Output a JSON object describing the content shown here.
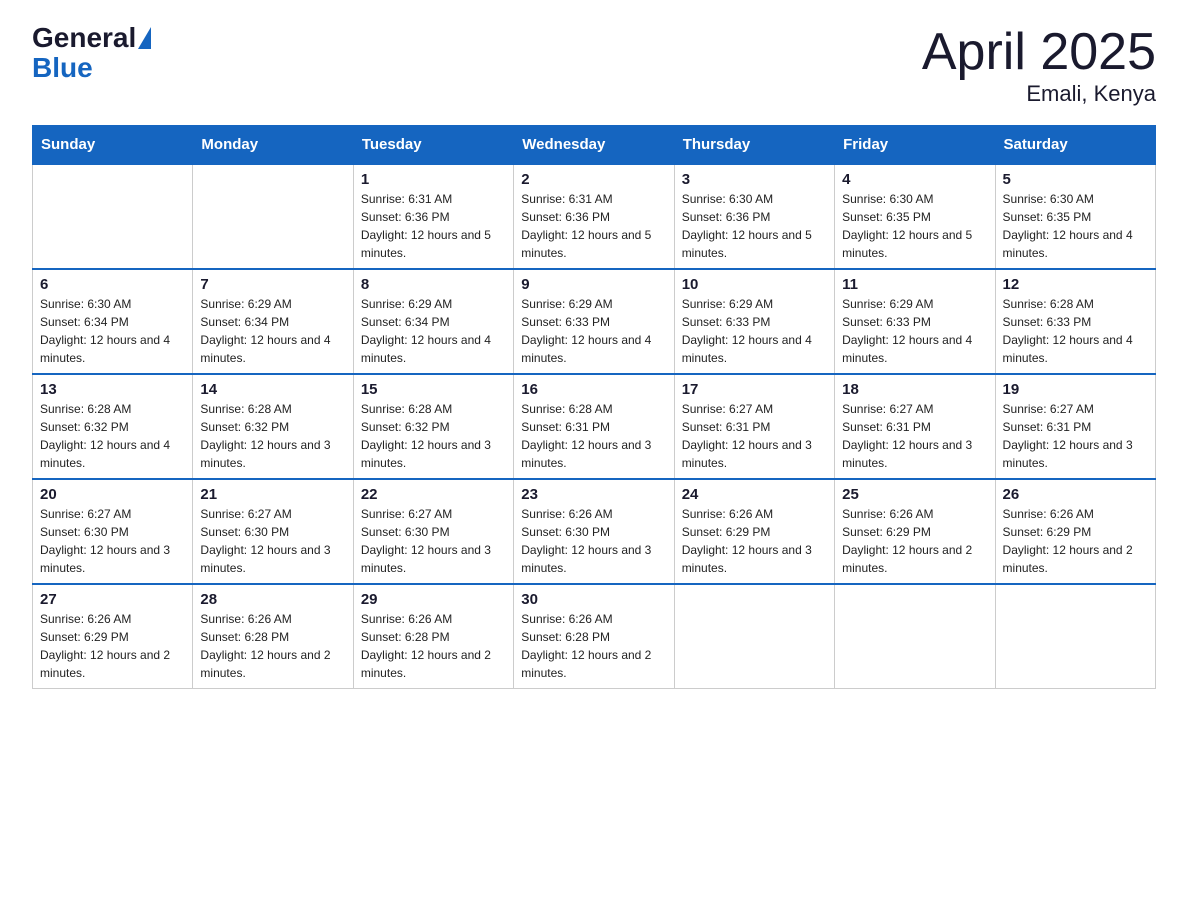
{
  "header": {
    "logo_general": "General",
    "logo_blue": "Blue",
    "title": "April 2025",
    "subtitle": "Emali, Kenya"
  },
  "columns": [
    "Sunday",
    "Monday",
    "Tuesday",
    "Wednesday",
    "Thursday",
    "Friday",
    "Saturday"
  ],
  "weeks": [
    [
      {
        "day": "",
        "sunrise": "",
        "sunset": "",
        "daylight": ""
      },
      {
        "day": "",
        "sunrise": "",
        "sunset": "",
        "daylight": ""
      },
      {
        "day": "1",
        "sunrise": "Sunrise: 6:31 AM",
        "sunset": "Sunset: 6:36 PM",
        "daylight": "Daylight: 12 hours and 5 minutes."
      },
      {
        "day": "2",
        "sunrise": "Sunrise: 6:31 AM",
        "sunset": "Sunset: 6:36 PM",
        "daylight": "Daylight: 12 hours and 5 minutes."
      },
      {
        "day": "3",
        "sunrise": "Sunrise: 6:30 AM",
        "sunset": "Sunset: 6:36 PM",
        "daylight": "Daylight: 12 hours and 5 minutes."
      },
      {
        "day": "4",
        "sunrise": "Sunrise: 6:30 AM",
        "sunset": "Sunset: 6:35 PM",
        "daylight": "Daylight: 12 hours and 5 minutes."
      },
      {
        "day": "5",
        "sunrise": "Sunrise: 6:30 AM",
        "sunset": "Sunset: 6:35 PM",
        "daylight": "Daylight: 12 hours and 4 minutes."
      }
    ],
    [
      {
        "day": "6",
        "sunrise": "Sunrise: 6:30 AM",
        "sunset": "Sunset: 6:34 PM",
        "daylight": "Daylight: 12 hours and 4 minutes."
      },
      {
        "day": "7",
        "sunrise": "Sunrise: 6:29 AM",
        "sunset": "Sunset: 6:34 PM",
        "daylight": "Daylight: 12 hours and 4 minutes."
      },
      {
        "day": "8",
        "sunrise": "Sunrise: 6:29 AM",
        "sunset": "Sunset: 6:34 PM",
        "daylight": "Daylight: 12 hours and 4 minutes."
      },
      {
        "day": "9",
        "sunrise": "Sunrise: 6:29 AM",
        "sunset": "Sunset: 6:33 PM",
        "daylight": "Daylight: 12 hours and 4 minutes."
      },
      {
        "day": "10",
        "sunrise": "Sunrise: 6:29 AM",
        "sunset": "Sunset: 6:33 PM",
        "daylight": "Daylight: 12 hours and 4 minutes."
      },
      {
        "day": "11",
        "sunrise": "Sunrise: 6:29 AM",
        "sunset": "Sunset: 6:33 PM",
        "daylight": "Daylight: 12 hours and 4 minutes."
      },
      {
        "day": "12",
        "sunrise": "Sunrise: 6:28 AM",
        "sunset": "Sunset: 6:33 PM",
        "daylight": "Daylight: 12 hours and 4 minutes."
      }
    ],
    [
      {
        "day": "13",
        "sunrise": "Sunrise: 6:28 AM",
        "sunset": "Sunset: 6:32 PM",
        "daylight": "Daylight: 12 hours and 4 minutes."
      },
      {
        "day": "14",
        "sunrise": "Sunrise: 6:28 AM",
        "sunset": "Sunset: 6:32 PM",
        "daylight": "Daylight: 12 hours and 3 minutes."
      },
      {
        "day": "15",
        "sunrise": "Sunrise: 6:28 AM",
        "sunset": "Sunset: 6:32 PM",
        "daylight": "Daylight: 12 hours and 3 minutes."
      },
      {
        "day": "16",
        "sunrise": "Sunrise: 6:28 AM",
        "sunset": "Sunset: 6:31 PM",
        "daylight": "Daylight: 12 hours and 3 minutes."
      },
      {
        "day": "17",
        "sunrise": "Sunrise: 6:27 AM",
        "sunset": "Sunset: 6:31 PM",
        "daylight": "Daylight: 12 hours and 3 minutes."
      },
      {
        "day": "18",
        "sunrise": "Sunrise: 6:27 AM",
        "sunset": "Sunset: 6:31 PM",
        "daylight": "Daylight: 12 hours and 3 minutes."
      },
      {
        "day": "19",
        "sunrise": "Sunrise: 6:27 AM",
        "sunset": "Sunset: 6:31 PM",
        "daylight": "Daylight: 12 hours and 3 minutes."
      }
    ],
    [
      {
        "day": "20",
        "sunrise": "Sunrise: 6:27 AM",
        "sunset": "Sunset: 6:30 PM",
        "daylight": "Daylight: 12 hours and 3 minutes."
      },
      {
        "day": "21",
        "sunrise": "Sunrise: 6:27 AM",
        "sunset": "Sunset: 6:30 PM",
        "daylight": "Daylight: 12 hours and 3 minutes."
      },
      {
        "day": "22",
        "sunrise": "Sunrise: 6:27 AM",
        "sunset": "Sunset: 6:30 PM",
        "daylight": "Daylight: 12 hours and 3 minutes."
      },
      {
        "day": "23",
        "sunrise": "Sunrise: 6:26 AM",
        "sunset": "Sunset: 6:30 PM",
        "daylight": "Daylight: 12 hours and 3 minutes."
      },
      {
        "day": "24",
        "sunrise": "Sunrise: 6:26 AM",
        "sunset": "Sunset: 6:29 PM",
        "daylight": "Daylight: 12 hours and 3 minutes."
      },
      {
        "day": "25",
        "sunrise": "Sunrise: 6:26 AM",
        "sunset": "Sunset: 6:29 PM",
        "daylight": "Daylight: 12 hours and 2 minutes."
      },
      {
        "day": "26",
        "sunrise": "Sunrise: 6:26 AM",
        "sunset": "Sunset: 6:29 PM",
        "daylight": "Daylight: 12 hours and 2 minutes."
      }
    ],
    [
      {
        "day": "27",
        "sunrise": "Sunrise: 6:26 AM",
        "sunset": "Sunset: 6:29 PM",
        "daylight": "Daylight: 12 hours and 2 minutes."
      },
      {
        "day": "28",
        "sunrise": "Sunrise: 6:26 AM",
        "sunset": "Sunset: 6:28 PM",
        "daylight": "Daylight: 12 hours and 2 minutes."
      },
      {
        "day": "29",
        "sunrise": "Sunrise: 6:26 AM",
        "sunset": "Sunset: 6:28 PM",
        "daylight": "Daylight: 12 hours and 2 minutes."
      },
      {
        "day": "30",
        "sunrise": "Sunrise: 6:26 AM",
        "sunset": "Sunset: 6:28 PM",
        "daylight": "Daylight: 12 hours and 2 minutes."
      },
      {
        "day": "",
        "sunrise": "",
        "sunset": "",
        "daylight": ""
      },
      {
        "day": "",
        "sunrise": "",
        "sunset": "",
        "daylight": ""
      },
      {
        "day": "",
        "sunrise": "",
        "sunset": "",
        "daylight": ""
      }
    ]
  ]
}
